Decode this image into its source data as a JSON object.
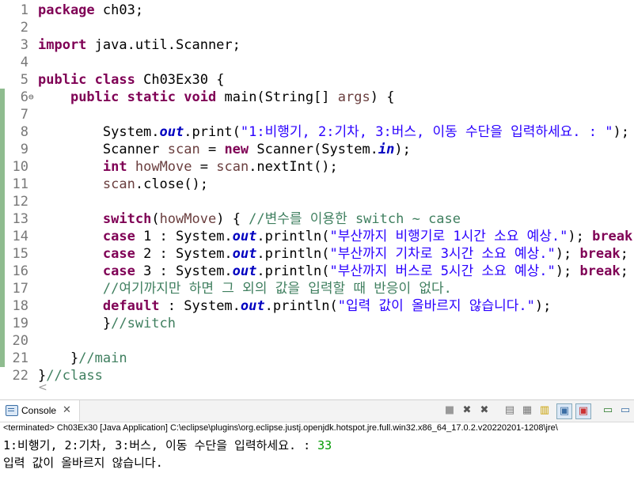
{
  "editor": {
    "lines": [
      {
        "n": "1",
        "tokens": [
          {
            "t": "package",
            "c": "kw"
          },
          {
            "t": " ch03;",
            "c": ""
          }
        ]
      },
      {
        "n": "2",
        "tokens": []
      },
      {
        "n": "3",
        "tokens": [
          {
            "t": "import",
            "c": "kw"
          },
          {
            "t": " java.util.Scanner;",
            "c": ""
          }
        ]
      },
      {
        "n": "4",
        "tokens": []
      },
      {
        "n": "5",
        "tokens": [
          {
            "t": "public",
            "c": "kw"
          },
          {
            "t": " ",
            "c": ""
          },
          {
            "t": "class",
            "c": "kw"
          },
          {
            "t": " Ch03Ex30 {",
            "c": ""
          }
        ]
      },
      {
        "n": "6",
        "fold": "⊖",
        "tokens": [
          {
            "t": "    ",
            "c": ""
          },
          {
            "t": "public",
            "c": "kw"
          },
          {
            "t": " ",
            "c": ""
          },
          {
            "t": "static",
            "c": "kw"
          },
          {
            "t": " ",
            "c": ""
          },
          {
            "t": "void",
            "c": "kw"
          },
          {
            "t": " main(String[] ",
            "c": ""
          },
          {
            "t": "args",
            "c": "var"
          },
          {
            "t": ") {",
            "c": ""
          }
        ]
      },
      {
        "n": "7",
        "tokens": []
      },
      {
        "n": "8",
        "tokens": [
          {
            "t": "        System.",
            "c": ""
          },
          {
            "t": "out",
            "c": "fld"
          },
          {
            "t": ".print(",
            "c": ""
          },
          {
            "t": "\"1:비행기, 2:기차, 3:버스, 이동 수단을 입력하세요. : \"",
            "c": "str"
          },
          {
            "t": ");",
            "c": ""
          }
        ]
      },
      {
        "n": "9",
        "tokens": [
          {
            "t": "        Scanner ",
            "c": ""
          },
          {
            "t": "scan",
            "c": "var"
          },
          {
            "t": " = ",
            "c": ""
          },
          {
            "t": "new",
            "c": "kw"
          },
          {
            "t": " Scanner(System.",
            "c": ""
          },
          {
            "t": "in",
            "c": "fld"
          },
          {
            "t": ");",
            "c": ""
          }
        ]
      },
      {
        "n": "10",
        "tokens": [
          {
            "t": "        ",
            "c": ""
          },
          {
            "t": "int",
            "c": "kw"
          },
          {
            "t": " ",
            "c": ""
          },
          {
            "t": "howMove",
            "c": "var"
          },
          {
            "t": " = ",
            "c": ""
          },
          {
            "t": "scan",
            "c": "var"
          },
          {
            "t": ".nextInt();",
            "c": ""
          }
        ]
      },
      {
        "n": "11",
        "tokens": [
          {
            "t": "        ",
            "c": ""
          },
          {
            "t": "scan",
            "c": "var"
          },
          {
            "t": ".close();",
            "c": ""
          }
        ]
      },
      {
        "n": "12",
        "tokens": []
      },
      {
        "n": "13",
        "tokens": [
          {
            "t": "        ",
            "c": ""
          },
          {
            "t": "switch",
            "c": "kw"
          },
          {
            "t": "(",
            "c": ""
          },
          {
            "t": "howMove",
            "c": "var"
          },
          {
            "t": ") { ",
            "c": ""
          },
          {
            "t": "//변수를 이용한 switch ~ case",
            "c": "cmt"
          }
        ]
      },
      {
        "n": "14",
        "tokens": [
          {
            "t": "        ",
            "c": ""
          },
          {
            "t": "case",
            "c": "kw"
          },
          {
            "t": " 1 : System.",
            "c": ""
          },
          {
            "t": "out",
            "c": "fld"
          },
          {
            "t": ".println(",
            "c": ""
          },
          {
            "t": "\"부산까지 비행기로 1시간 소요 예상.\"",
            "c": "str"
          },
          {
            "t": "); ",
            "c": ""
          },
          {
            "t": "break",
            "c": "kw"
          },
          {
            "t": ";",
            "c": ""
          }
        ]
      },
      {
        "n": "15",
        "tokens": [
          {
            "t": "        ",
            "c": ""
          },
          {
            "t": "case",
            "c": "kw"
          },
          {
            "t": " 2 : System.",
            "c": ""
          },
          {
            "t": "out",
            "c": "fld"
          },
          {
            "t": ".println(",
            "c": ""
          },
          {
            "t": "\"부산까지 기차로 3시간 소요 예상.\"",
            "c": "str"
          },
          {
            "t": "); ",
            "c": ""
          },
          {
            "t": "break",
            "c": "kw"
          },
          {
            "t": ";",
            "c": ""
          }
        ]
      },
      {
        "n": "16",
        "tokens": [
          {
            "t": "        ",
            "c": ""
          },
          {
            "t": "case",
            "c": "kw"
          },
          {
            "t": " 3 : System.",
            "c": ""
          },
          {
            "t": "out",
            "c": "fld"
          },
          {
            "t": ".println(",
            "c": ""
          },
          {
            "t": "\"부산까지 버스로 5시간 소요 예상.\"",
            "c": "str"
          },
          {
            "t": "); ",
            "c": ""
          },
          {
            "t": "break",
            "c": "kw"
          },
          {
            "t": ";",
            "c": ""
          }
        ]
      },
      {
        "n": "17",
        "tokens": [
          {
            "t": "        ",
            "c": ""
          },
          {
            "t": "//여기까지만 하면 그 외의 값을 입력할 때 반응이 없다.",
            "c": "cmt"
          }
        ]
      },
      {
        "n": "18",
        "tokens": [
          {
            "t": "        ",
            "c": ""
          },
          {
            "t": "default",
            "c": "kw"
          },
          {
            "t": " : System.",
            "c": ""
          },
          {
            "t": "out",
            "c": "fld"
          },
          {
            "t": ".println(",
            "c": ""
          },
          {
            "t": "\"입력 값이 올바르지 않습니다.\"",
            "c": "str"
          },
          {
            "t": ");",
            "c": ""
          }
        ]
      },
      {
        "n": "19",
        "tokens": [
          {
            "t": "        }",
            "c": ""
          },
          {
            "t": "//switch",
            "c": "cmt"
          }
        ]
      },
      {
        "n": "20",
        "tokens": []
      },
      {
        "n": "21",
        "tokens": [
          {
            "t": "    }",
            "c": ""
          },
          {
            "t": "//main",
            "c": "cmt"
          }
        ]
      },
      {
        "n": "22",
        "tokens": [
          {
            "t": "}",
            "c": ""
          },
          {
            "t": "//class",
            "c": "cmt"
          }
        ]
      }
    ],
    "scroll_left_glyph": "<"
  },
  "console": {
    "tab_label": "Console",
    "close_glyph": "✕",
    "status": "<terminated> Ch03Ex30 [Java Application] C:\\eclipse\\plugins\\org.eclipse.justj.openjdk.hotspot.jre.full.win32.x86_64_17.0.2.v20220201-1208\\jre\\",
    "output_prompt": "1:비행기, 2:기차, 3:버스, 이동 수단을 입력하세요. : ",
    "output_input": "33",
    "output_line2": "입력 값이 올바르지 않습니다.",
    "toolbar_icons": [
      "terminate-icon",
      "remove-launch-icon",
      "remove-all-icon",
      "clear-console-icon",
      "scroll-lock-icon",
      "word-wrap-icon",
      "show-on-output-icon",
      "show-on-error-icon",
      "pin-console-icon",
      "display-console-icon"
    ]
  },
  "colors": {
    "keyword": "#7f0055",
    "string": "#2a00ff",
    "comment": "#3f7f5f",
    "field": "#0000c0",
    "variable": "#6a3e3e",
    "console_input": "#009900"
  }
}
